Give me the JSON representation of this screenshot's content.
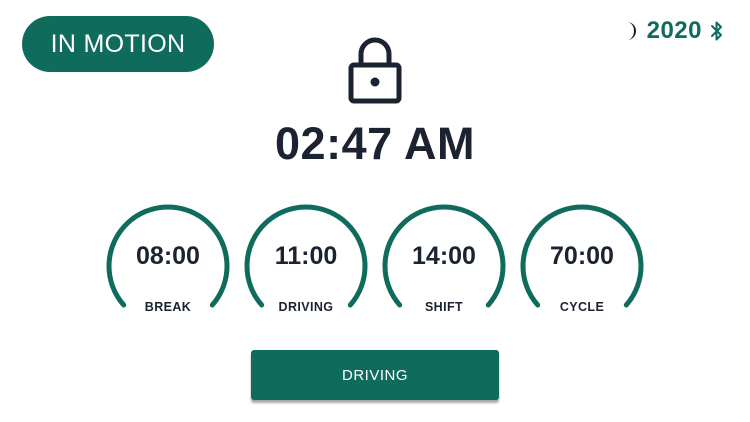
{
  "status": {
    "label": "IN MOTION",
    "color": "#0f6b5c"
  },
  "header": {
    "theme_icon": "moon-icon",
    "vehicle_number": "2020",
    "connection_icon": "bluetooth-icon"
  },
  "lock_icon": "lock-icon",
  "clock": {
    "time": "02:47 AM"
  },
  "timers": [
    {
      "value": "08:00",
      "label": "BREAK"
    },
    {
      "value": "11:00",
      "label": "DRIVING"
    },
    {
      "value": "14:00",
      "label": "SHIFT"
    },
    {
      "value": "70:00",
      "label": "CYCLE"
    }
  ],
  "mode_button": {
    "label": "DRIVING"
  },
  "colors": {
    "accent": "#0f6b5c",
    "text": "#1b2330",
    "background": "#ffffff"
  }
}
